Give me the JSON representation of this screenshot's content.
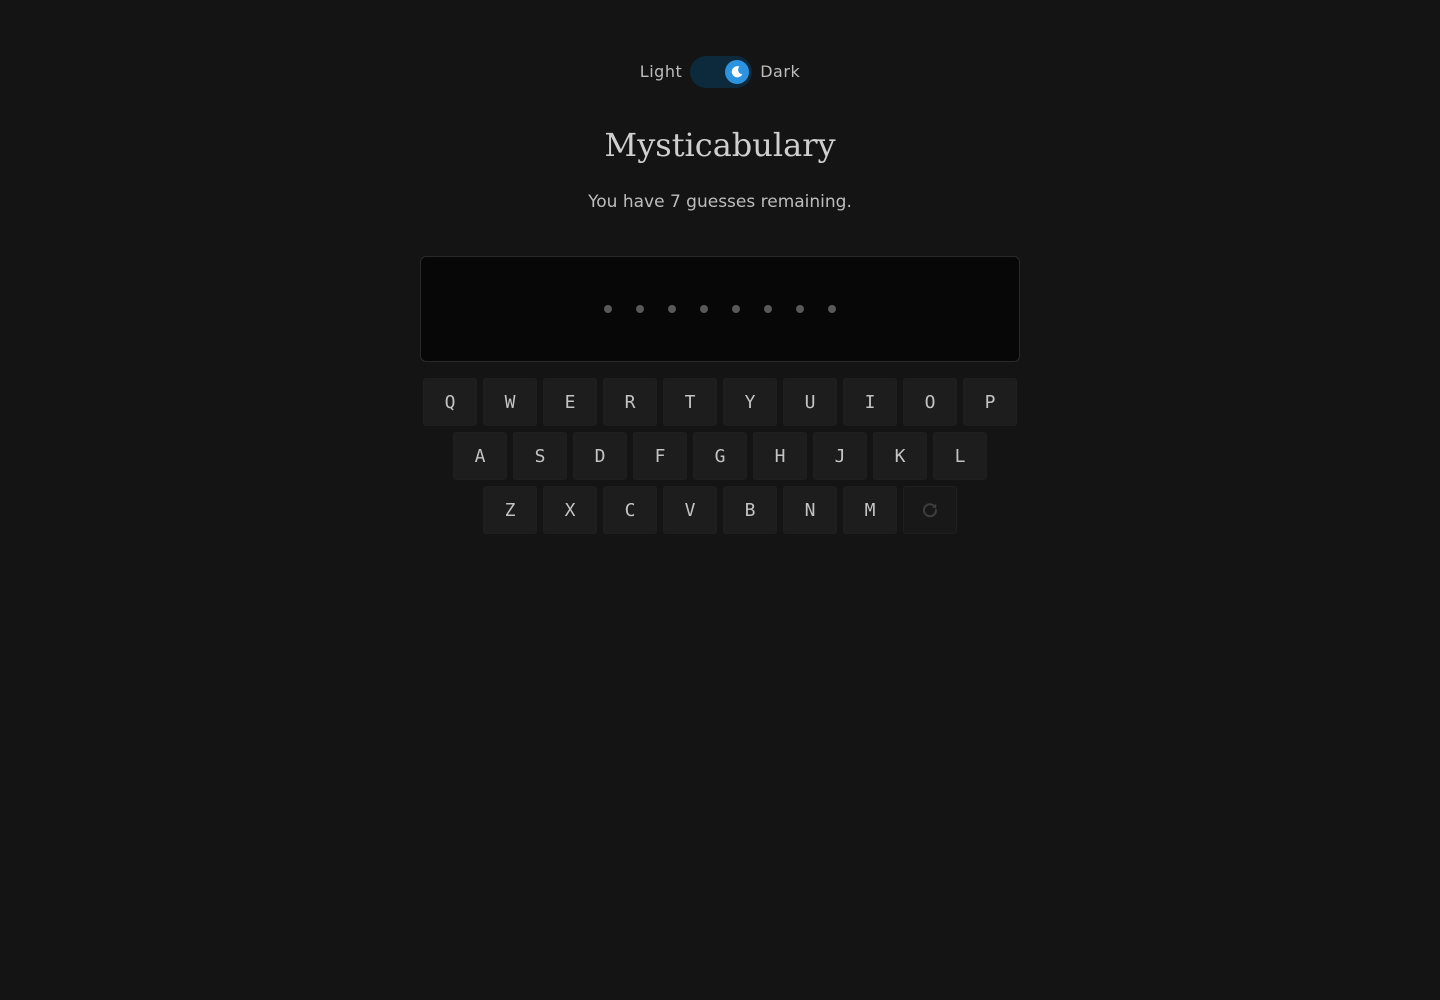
{
  "theme": {
    "light_label": "Light",
    "dark_label": "Dark",
    "mode": "dark",
    "accent_color": "#2b93e0",
    "track_color": "#0d2a3c"
  },
  "header": {
    "title": "Mysticabulary",
    "status": "You have 7 guesses remaining."
  },
  "game": {
    "guesses_remaining": 7,
    "word_length": 8
  },
  "keyboard": {
    "rows": [
      [
        "Q",
        "W",
        "E",
        "R",
        "T",
        "Y",
        "U",
        "I",
        "O",
        "P"
      ],
      [
        "A",
        "S",
        "D",
        "F",
        "G",
        "H",
        "J",
        "K",
        "L"
      ],
      [
        "Z",
        "X",
        "C",
        "V",
        "B",
        "N",
        "M"
      ]
    ],
    "reset_icon": "refresh-icon"
  }
}
